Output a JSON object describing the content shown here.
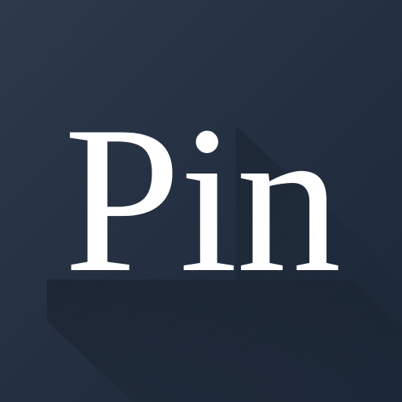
{
  "logo": {
    "text": "Pin",
    "text_color": "#ffffff",
    "background_color": "#253142",
    "shadow_color": "#18212e"
  }
}
